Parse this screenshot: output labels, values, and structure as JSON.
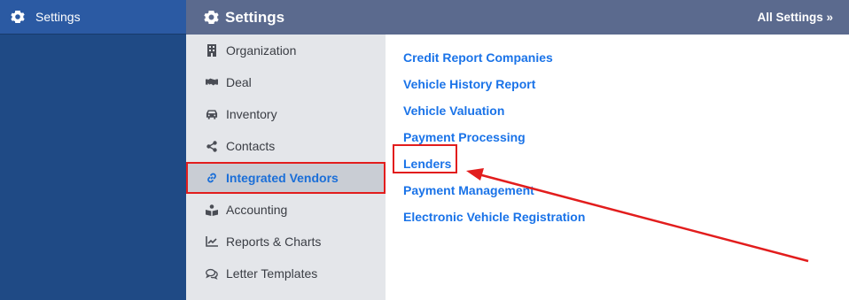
{
  "app_sidebar": {
    "items": [
      {
        "label": "Settings",
        "icon": "gear-icon"
      }
    ]
  },
  "header": {
    "title": "Settings",
    "title_icon": "gear-icon",
    "all_settings": "All Settings »"
  },
  "categories": [
    {
      "label": "Organization",
      "icon": "building-icon",
      "active": false
    },
    {
      "label": "Deal",
      "icon": "handshake-icon",
      "active": false
    },
    {
      "label": "Inventory",
      "icon": "car-icon",
      "active": false
    },
    {
      "label": "Contacts",
      "icon": "share-icon",
      "active": false
    },
    {
      "label": "Integrated Vendors",
      "icon": "link-icon",
      "active": true
    },
    {
      "label": "Accounting",
      "icon": "book-reader-icon",
      "active": false
    },
    {
      "label": "Reports & Charts",
      "icon": "line-chart-icon",
      "active": false
    },
    {
      "label": "Letter Templates",
      "icon": "comments-icon",
      "active": false
    }
  ],
  "links": [
    {
      "label": "Credit Report Companies"
    },
    {
      "label": "Vehicle History Report"
    },
    {
      "label": "Vehicle Valuation"
    },
    {
      "label": "Payment Processing"
    },
    {
      "label": "Lenders"
    },
    {
      "label": "Payment Management"
    },
    {
      "label": "Electronic Vehicle Registration"
    }
  ],
  "colors": {
    "sidebar": "#1f4a85",
    "header": "#5b6a8e",
    "link": "#1a73e8",
    "annotation": "#e21d1d"
  }
}
